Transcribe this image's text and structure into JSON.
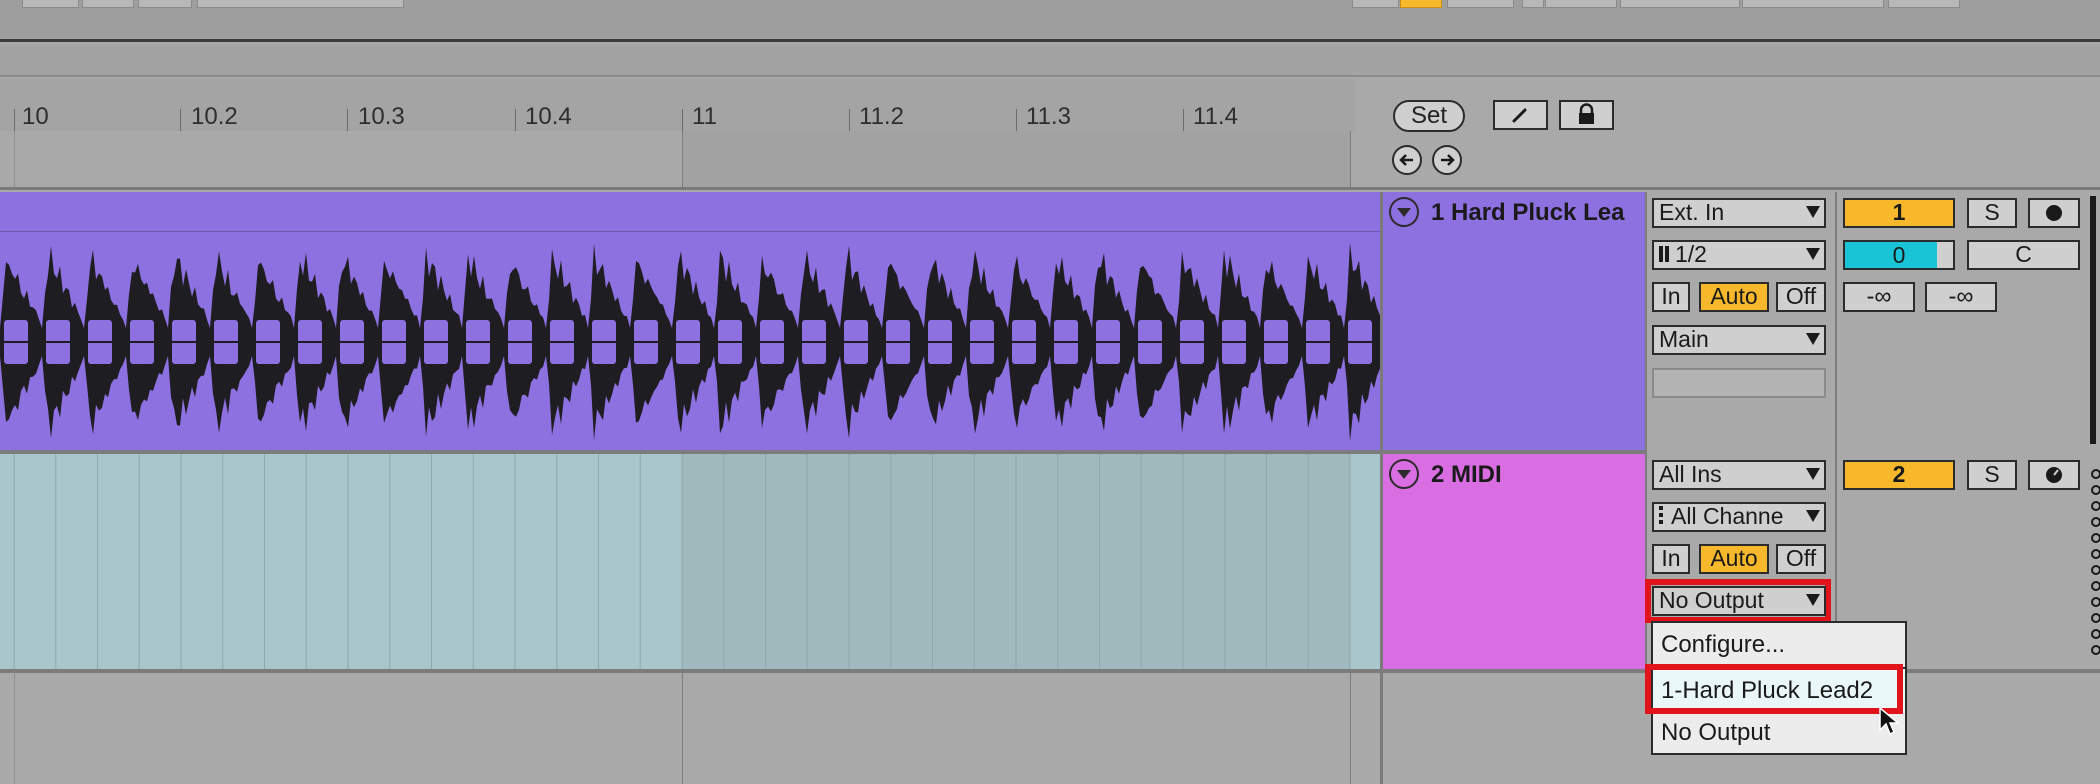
{
  "ruler": {
    "labels": [
      "10",
      "10.2",
      "10.3",
      "10.4",
      "11",
      "11.2",
      "11.3",
      "11.4"
    ]
  },
  "arrangement": {
    "set_label": "Set",
    "draw_mode_icon": "pencil-icon",
    "lock_icon": "lock-icon",
    "prev_locator_icon": "arrow-left-icon",
    "next_locator_icon": "arrow-right-icon"
  },
  "tracks": [
    {
      "name": "1 Hard Pluck Lea",
      "color": "#8d71e0",
      "input_type": "Ext. In",
      "input_channel": "1/2",
      "monitor": [
        "In",
        "Auto",
        "Off"
      ],
      "output": "Main",
      "number": "1",
      "solo": "S",
      "pan_value": "0",
      "pan_center": "C",
      "peak_left": "-∞",
      "peak_right": "-∞"
    },
    {
      "name": "2 MIDI",
      "color": "#d96ee2",
      "input_type": "All Ins",
      "input_channel": "All Channe",
      "monitor": [
        "In",
        "Auto",
        "Off"
      ],
      "output": "No Output",
      "number": "2",
      "solo": "S"
    }
  ],
  "output_menu": {
    "items": [
      "Configure...",
      "1-Hard Pluck Lead2",
      "No Output"
    ],
    "selected": "1-Hard Pluck Lead2"
  },
  "colors": {
    "accent_orange": "#f7b92b",
    "highlight_red": "#e0141a",
    "pan_cyan": "#18c4d6"
  }
}
